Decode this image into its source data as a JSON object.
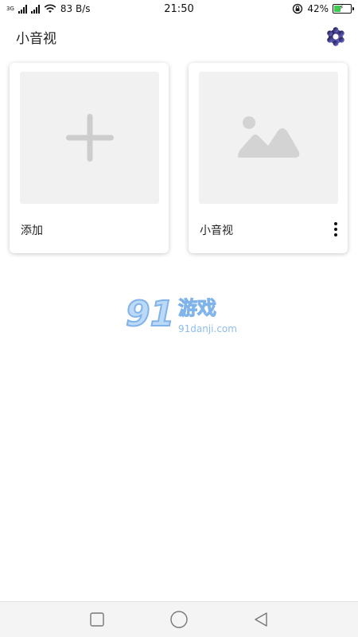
{
  "status_bar": {
    "network_type": "3G",
    "net_speed": "83 B/s",
    "time": "21:50",
    "battery_percent": "42%",
    "battery_level": 0.42,
    "battery_color": "#3ecb52"
  },
  "header": {
    "title": "小音视",
    "settings_icon": "gear-icon"
  },
  "cards": [
    {
      "label": "添加",
      "icon": "plus-icon"
    },
    {
      "label": "小音视",
      "icon": "image-placeholder-icon"
    }
  ],
  "watermark": {
    "logo_text": "91",
    "logo_cn": "游戏",
    "url": "91danji.com"
  },
  "nav_bar": {
    "buttons": [
      "recent-apps",
      "home",
      "back"
    ]
  }
}
